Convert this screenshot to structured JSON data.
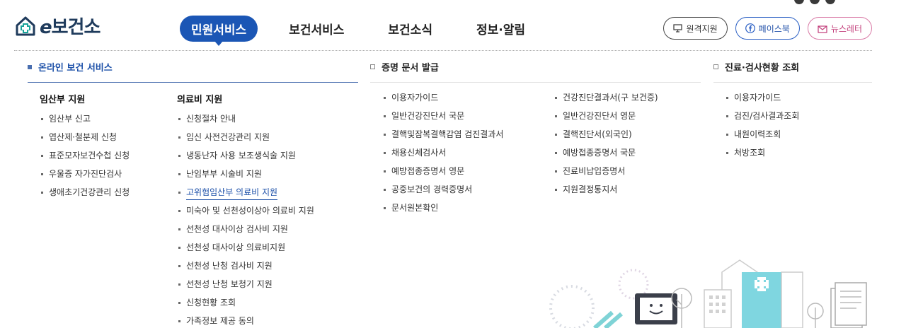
{
  "header": {
    "logo_text": "보건소",
    "logo_e": "e",
    "nav": [
      "민원서비스",
      "보건서비스",
      "보건소식",
      "정보·알림"
    ],
    "active_nav": "민원서비스",
    "util": {
      "remote": "원격지원",
      "facebook": "페이스북",
      "newsletter": "뉴스레터"
    }
  },
  "sections": {
    "online": {
      "title": "온라인 보건 서비스",
      "groups": [
        {
          "heading": "임산부 지원",
          "items": [
            "임산부 신고",
            "엽산제·철분제 신청",
            "표준모자보건수첩 신청",
            "우울증 자가진단검사",
            "생애초기건강관리 신청"
          ]
        },
        {
          "heading": "의료비 지원",
          "items": [
            "신청절차 안내",
            "임신 사전건강관리 지원",
            "냉동난자 사용 보조생식술 지원",
            "난임부부 시술비 지원",
            "고위험임산부 의료비 지원",
            "미숙아 및 선천성이상아 의료비 지원",
            "선천성 대사이상 검사비 지원",
            "선천성 대사이상 의료비지원",
            "선천성 난청 검사비 지원",
            "선천성 난청 보청기 지원",
            "신청현황 조회",
            "가족정보 제공 동의"
          ],
          "highlighted": "고위험임산부 의료비 지원"
        }
      ]
    },
    "certificates": {
      "title": "증명 문서 발급",
      "col1": [
        "이용자가이드",
        "일반건강진단서 국문",
        "결핵및잠복결핵감염 검진결과서",
        "채용신체검사서",
        "예방접종증명서 영문",
        "공중보건의 경력증명서",
        "문서원본확인"
      ],
      "col2": [
        "건강진단결과서(구 보건증)",
        "일반건강진단서 영문",
        "결핵진단서(외국인)",
        "예방접종증명서 국문",
        "진료비납입증명서",
        "지원결정통지서"
      ]
    },
    "inquiry": {
      "title": "진료·검사현황 조회",
      "items": [
        "이용자가이드",
        "검진/검사결과조회",
        "내원이력조회",
        "처방조회"
      ]
    }
  },
  "colors": {
    "brand_blue": "#1b56b5",
    "accent_blue": "#1b4fa8",
    "logo_green": "#1aa39a"
  }
}
